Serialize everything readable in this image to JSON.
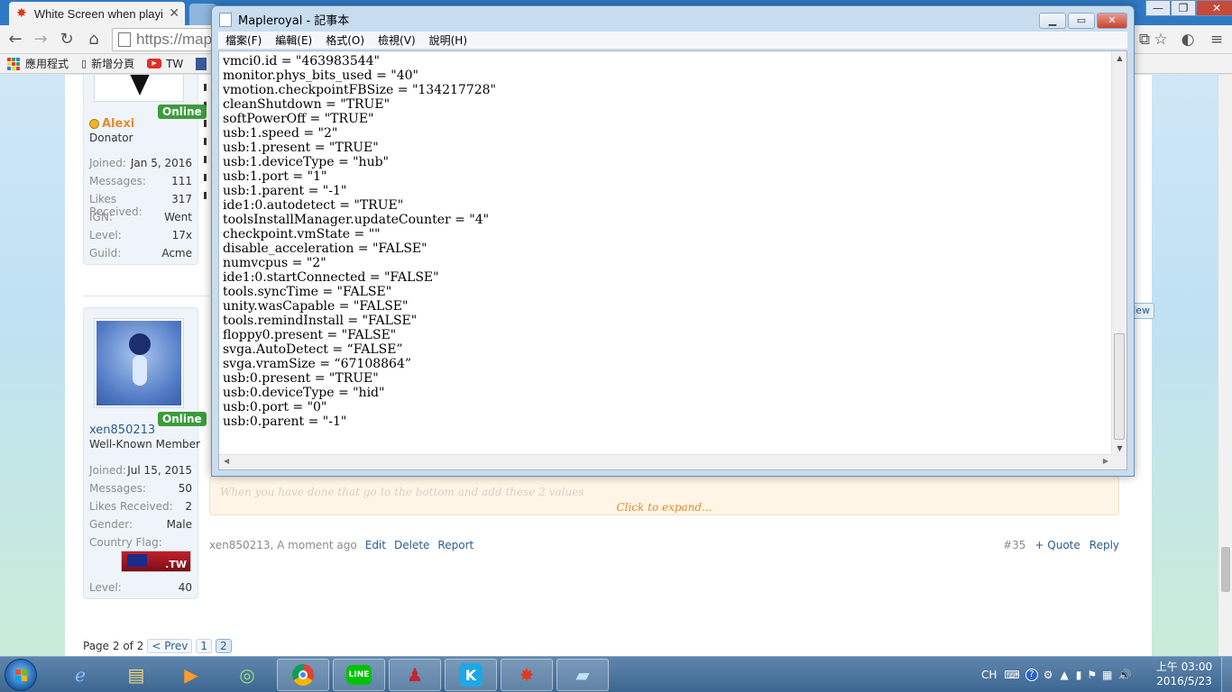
{
  "browser": {
    "tab_title": "White Screen when playing",
    "tab_close": "✕",
    "url": "https://map",
    "bookmarks": [
      {
        "label": "應用程式"
      },
      {
        "label": "新增分頁"
      },
      {
        "label": "TW"
      }
    ],
    "window_controls": {
      "minimize": "—",
      "maximize": "❐",
      "close": "✕"
    }
  },
  "forum": {
    "user1": {
      "name": "Alexi",
      "title": "Donator",
      "online": "Online",
      "stats": [
        {
          "k": "Joined:",
          "v": "Jan 5, 2016"
        },
        {
          "k": "Messages:",
          "v": "111"
        },
        {
          "k": "Likes Received:",
          "v": "317"
        },
        {
          "k": "IGN:",
          "v": "Went"
        },
        {
          "k": "Level:",
          "v": "17x"
        },
        {
          "k": "Guild:",
          "v": "Acme"
        }
      ]
    },
    "user2": {
      "name": "xen850213",
      "title": "Well-Known Member",
      "online": "Online",
      "stats": [
        {
          "k": "Joined:",
          "v": "Jul 15, 2015"
        },
        {
          "k": "Messages:",
          "v": "50"
        },
        {
          "k": "Likes Received:",
          "v": "2"
        },
        {
          "k": "Gender:",
          "v": "Male"
        }
      ],
      "country_flag_label": "Country Flag:",
      "flag_text": ".TW",
      "level_k": "Level:",
      "level_v": "40"
    },
    "quote": {
      "faint_text": "When you have done that go to the bottom and add these 2 values",
      "expand": "Click to expand..."
    },
    "post_meta": {
      "author_time": "xen850213, A moment ago",
      "edit": "Edit",
      "delete": "Delete",
      "report": "Report",
      "number": "#35",
      "quote": "+ Quote",
      "reply": "Reply"
    },
    "pagination": {
      "label": "Page 2 of 2",
      "prev": "< Prev",
      "pages": [
        "1",
        "2"
      ]
    },
    "new_button": "New"
  },
  "notepad": {
    "title": "Mapleroyal - 記事本",
    "menu": [
      "檔案(F)",
      "編輯(E)",
      "格式(O)",
      "檢視(V)",
      "說明(H)"
    ],
    "lines": [
      "vmci0.id = \"463983544\"",
      "monitor.phys_bits_used = \"40\"",
      "vmotion.checkpointFBSize = \"134217728\"",
      "cleanShutdown = \"TRUE\"",
      "softPowerOff = \"TRUE\"",
      "usb:1.speed = \"2\"",
      "usb:1.present = \"TRUE\"",
      "usb:1.deviceType = \"hub\"",
      "usb:1.port = \"1\"",
      "usb:1.parent = \"-1\"",
      "ide1:0.autodetect = \"TRUE\"",
      "toolsInstallManager.updateCounter = \"4\"",
      "checkpoint.vmState = \"\"",
      "disable_acceleration = \"FALSE\"",
      "numvcpus = \"2\"",
      "ide1:0.startConnected = \"FALSE\"",
      "tools.syncTime = \"FALSE\"",
      "unity.wasCapable = \"FALSE\"",
      "tools.remindInstall = \"FALSE\"",
      "floppy0.present = \"FALSE\"",
      "svga.AutoDetect = “FALSE”",
      "svga.vramSize = “67108864”",
      "usb:0.present = \"TRUE\"",
      "usb:0.deviceType = \"hid\"",
      "usb:0.port = \"0\"",
      "usb:0.parent = \"-1\""
    ]
  },
  "taskbar": {
    "apps": [
      "ie-icon",
      "explorer-icon",
      "media-player-icon",
      "qq-icon",
      "chrome-icon",
      "line-icon",
      "game-icon",
      "k-icon",
      "maple-icon",
      "notepad-icon"
    ],
    "line_label": "LINE",
    "k_label": "K",
    "lang": "CH",
    "time": "上午 03:00",
    "date": "2016/5/23"
  },
  "colors": {
    "accent": "#2b5d91",
    "online": "#3c9b3c",
    "expand": "#e58a2e"
  }
}
